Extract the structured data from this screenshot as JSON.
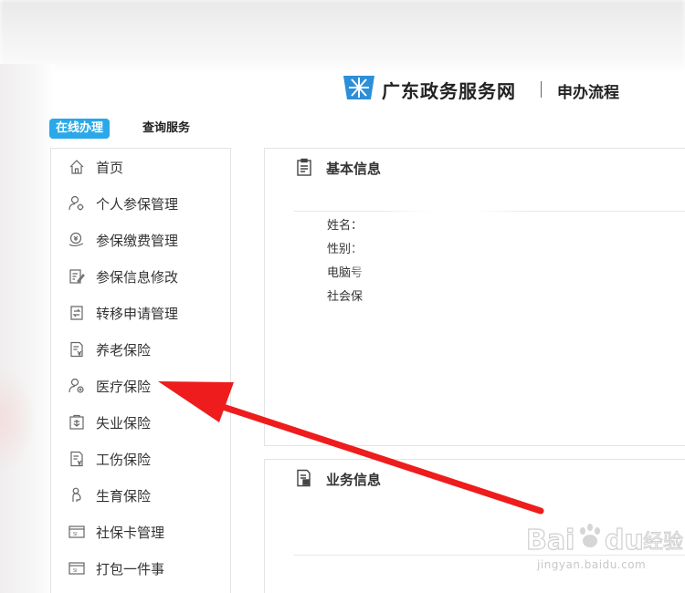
{
  "header": {
    "site_title": "广东政务服务网",
    "subtitle": "申办流程"
  },
  "tabs": [
    {
      "label": "在线办理",
      "active": true
    },
    {
      "label": "查询服务",
      "active": false
    }
  ],
  "sidebar": {
    "items": [
      {
        "label": "首页",
        "icon": "home-icon"
      },
      {
        "label": "个人参保管理",
        "icon": "user-gear-icon"
      },
      {
        "label": "参保缴费管理",
        "icon": "payment-icon"
      },
      {
        "label": "参保信息修改",
        "icon": "edit-doc-icon"
      },
      {
        "label": "转移申请管理",
        "icon": "transfer-icon"
      },
      {
        "label": "养老保险",
        "icon": "doc-yen-icon"
      },
      {
        "label": "医疗保险",
        "icon": "user-medical-icon"
      },
      {
        "label": "失业保险",
        "icon": "unemployment-icon"
      },
      {
        "label": "工伤保险",
        "icon": "doc-yen-icon"
      },
      {
        "label": "生育保险",
        "icon": "maternity-icon"
      },
      {
        "label": "社保卡管理",
        "icon": "card-icon"
      },
      {
        "label": "打包一件事",
        "icon": "card-icon"
      }
    ]
  },
  "basic_info": {
    "title": "基本信息",
    "fields": [
      "姓名：",
      "性别：",
      "电脑号",
      "社会保"
    ]
  },
  "business_info": {
    "title": "业务信息"
  },
  "watermark": {
    "brand": "Bai du 经验",
    "url": "jingyan.baidu.com"
  },
  "colors": {
    "accent": "#2aa8e8",
    "arrow": "#ee1c1c",
    "logo": "#2c8fd8"
  }
}
